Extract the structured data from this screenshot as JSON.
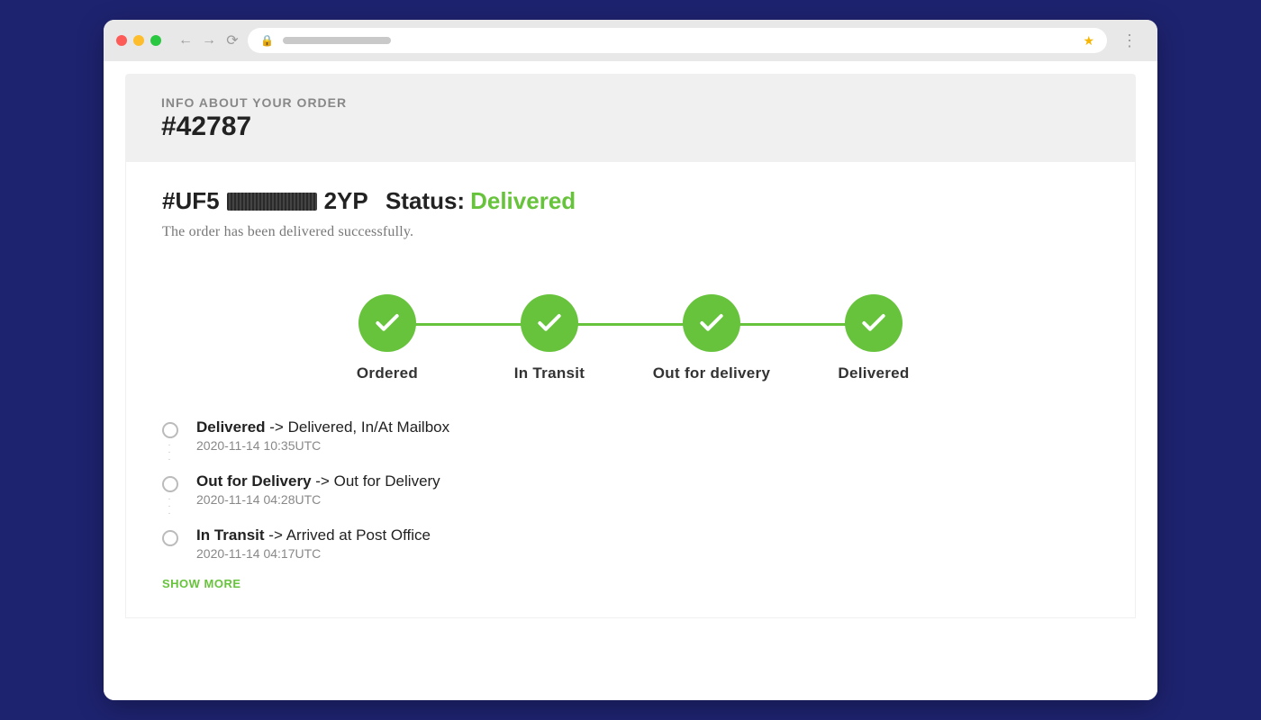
{
  "header": {
    "eyebrow": "INFO ABOUT YOUR ORDER",
    "order_number": "#42787"
  },
  "tracking": {
    "prefix": "#UF5",
    "suffix": "2YP",
    "status_label": "Status:",
    "status_value": "Delivered",
    "subtext": "The order has been delivered successfully."
  },
  "steps": [
    {
      "label": "Ordered",
      "done": true
    },
    {
      "label": "In Transit",
      "done": true
    },
    {
      "label": "Out for delivery",
      "done": true
    },
    {
      "label": "Delivered",
      "done": true
    }
  ],
  "events": [
    {
      "stage": "Delivered",
      "detail": "Delivered, In/At Mailbox",
      "time": "2020-11-14 10:35UTC"
    },
    {
      "stage": "Out for Delivery",
      "detail": "Out for Delivery",
      "time": "2020-11-14 04:28UTC"
    },
    {
      "stage": "In Transit",
      "detail": "Arrived at Post Office",
      "time": "2020-11-14 04:17UTC"
    }
  ],
  "show_more": "SHOW MORE",
  "arrow": " -> "
}
